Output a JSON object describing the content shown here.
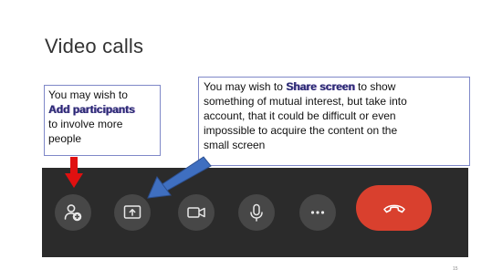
{
  "slide": {
    "title": "Video calls",
    "page_number": "15"
  },
  "callout_left": {
    "line1": "You may wish to",
    "emphasis": "Add participants",
    "line3": "to involve more",
    "line4": "people"
  },
  "callout_right": {
    "prefix": "You may wish to",
    "emphasis": "Share screen",
    "suffix": "to show",
    "line2": "something of mutual interest, but  take into",
    "line3": "account, that it could be difficult or even",
    "line4": "impossible to acquire the content on the",
    "line5": "small screen"
  },
  "call_controls": [
    {
      "name": "add-participant",
      "icon": "add-person-icon"
    },
    {
      "name": "share-screen",
      "icon": "share-screen-icon"
    },
    {
      "name": "camera",
      "icon": "video-camera-icon"
    },
    {
      "name": "microphone",
      "icon": "microphone-icon"
    },
    {
      "name": "more",
      "icon": "more-icon"
    },
    {
      "name": "hang-up",
      "icon": "hang-up-icon"
    }
  ],
  "colors": {
    "callbar_bg": "#2b2b2b",
    "button_bg": "#474747",
    "hangup_red": "#d9402e",
    "arrow_red": "#e01010",
    "arrow_blue": "#3f6fc0",
    "callout_border": "#7f88c8"
  }
}
